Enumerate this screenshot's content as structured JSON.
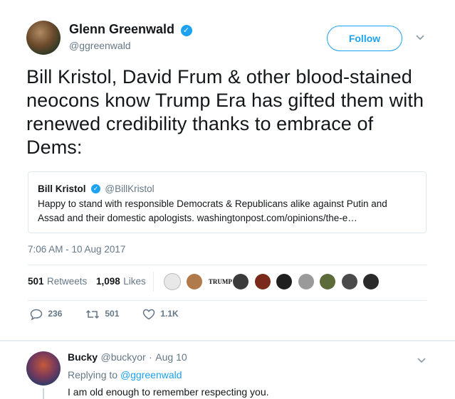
{
  "tweet": {
    "author_name": "Glenn Greenwald",
    "author_handle": "@ggreenwald",
    "follow_label": "Follow",
    "text": "Bill Kristol, David Frum & other blood-stained neocons know Trump Era has gifted them with renewed credibility thanks to embrace of Dems:",
    "timestamp": "7:06 AM - 10 Aug 2017",
    "retweets_count": "501",
    "retweets_label": "Retweets",
    "likes_count": "1,098",
    "likes_label": "Likes",
    "actions": {
      "reply_count": "236",
      "retweet_count": "501",
      "like_count": "1.1K"
    },
    "likers_badge": "TRUMP"
  },
  "quote": {
    "author_name": "Bill Kristol",
    "author_handle": "@BillKristol",
    "text_line1": "Happy to stand with responsible Democrats & Republicans alike against Putin and",
    "text_line2": "Assad and their domestic apologists. washingtonpost.com/opinions/the-e…"
  },
  "reply": {
    "author_name": "Bucky",
    "author_handle": "@buckyor",
    "separator": "·",
    "date": "Aug 10",
    "replying_prefix": "Replying to",
    "replying_to": "@ggreenwald",
    "text": "I am old enough to remember respecting you."
  },
  "colors": {
    "accent": "#1da1f2",
    "text": "#14171a",
    "muted": "#657786",
    "border": "#e1e8ed"
  },
  "icons": [
    "verified-badge-icon",
    "chevron-down-icon",
    "reply-icon",
    "retweet-icon",
    "like-icon"
  ]
}
